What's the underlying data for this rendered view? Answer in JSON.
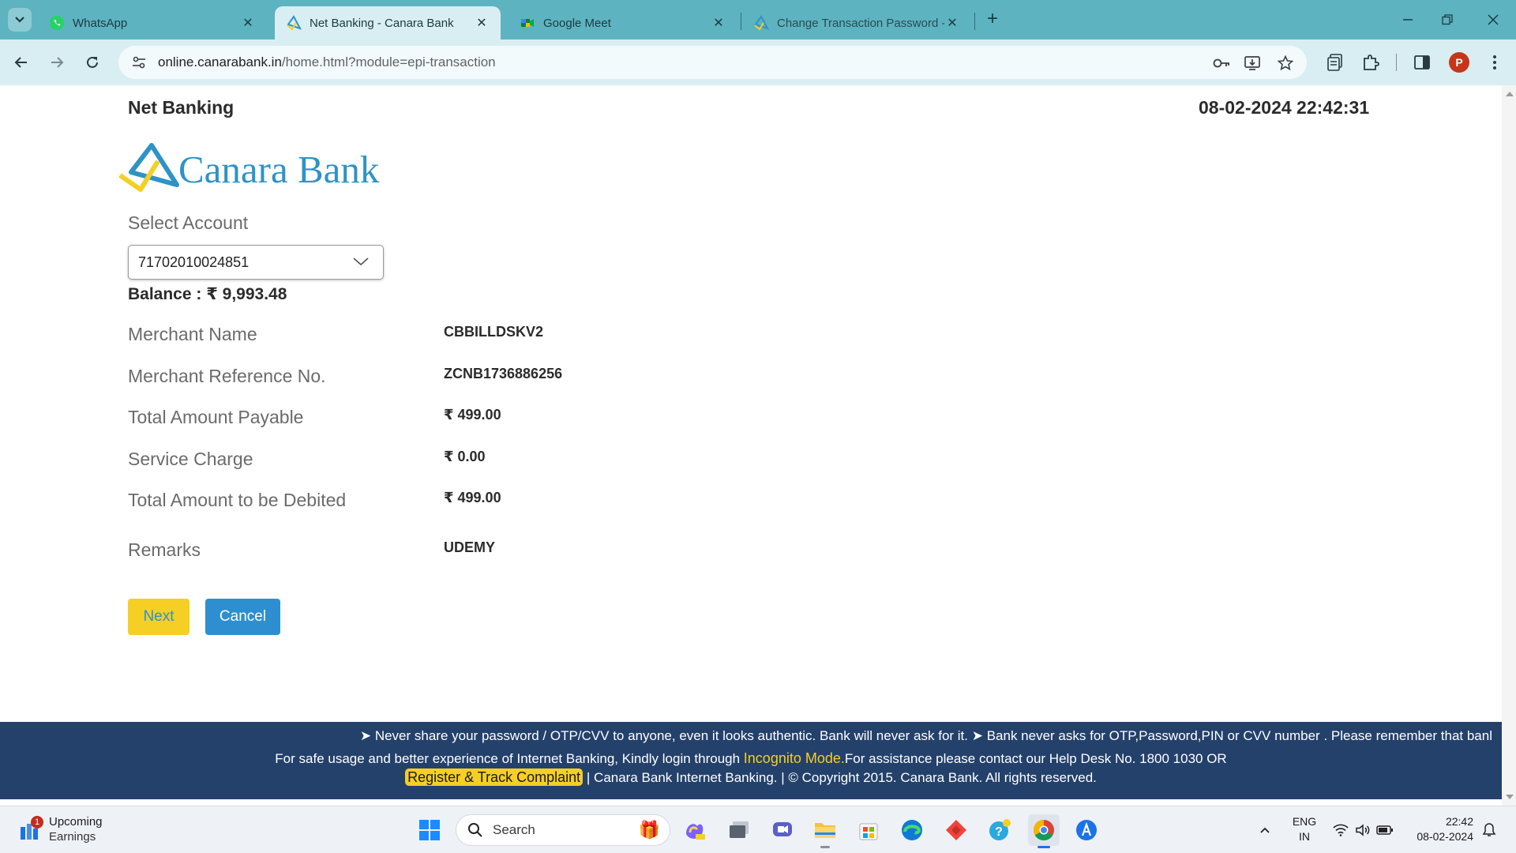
{
  "browser": {
    "tabs": [
      {
        "title": "WhatsApp",
        "icon": "whatsapp-icon",
        "active": false
      },
      {
        "title": "Net Banking - Canara Bank",
        "icon": "canara-bank-icon",
        "active": true
      },
      {
        "title": "Google Meet",
        "icon": "google-meet-icon",
        "active": false
      },
      {
        "title": "Change Transaction Password -",
        "icon": "canara-bank-icon",
        "active": false
      }
    ],
    "url": {
      "domain": "online.canarabank.in",
      "path": "/home.html?module=epi-transaction"
    },
    "profile_initial": "P"
  },
  "page": {
    "header_title": "Net Banking",
    "datetime": "08-02-2024 22:42:31",
    "bank_name": "Canara Bank",
    "select_account_label": "Select Account",
    "selected_account": "71702010024851",
    "balance": "Balance : ₹ 9,993.48",
    "details": [
      {
        "label": "Merchant Name",
        "value": "CBBILLDSKV2"
      },
      {
        "label": "Merchant Reference No.",
        "value": "ZCNB1736886256"
      },
      {
        "label": "Total Amount Payable",
        "value": "₹ 499.00"
      },
      {
        "label": "Service Charge",
        "value": "₹ 0.00"
      },
      {
        "label": "Total Amount to be Debited",
        "value": "₹ 499.00"
      },
      {
        "label": "Remarks",
        "value": "UDEMY"
      }
    ],
    "buttons": {
      "next": "Next",
      "cancel": "Cancel"
    },
    "footer": {
      "ticker": "➤ Never share your password / OTP/CVV to anyone, even it looks authentic. Bank will never ask for it. ➤ Bank never asks for OTP,Password,PIN or CVV number . Please remember that banl",
      "line1_prefix": "For safe usage and better experience of Internet Banking, Kindly login through ",
      "line1_highlight": "Incognito Mode.",
      "line1_suffix": "For assistance please contact our Help Desk No. 1800 1030 OR",
      "complaint_link": "Register & Track Complaint",
      "line2_suffix": "| Canara Bank Internet Banking. | © Copyright 2015. Canara Bank. All rights reserved."
    },
    "colors": {
      "brand_blue": "#2e93c6",
      "brand_yellow": "#f5cf23",
      "footer_bg": "#24416b",
      "tabstrip_bg": "#5db3c0"
    }
  },
  "taskbar": {
    "widget_badge": "1",
    "widget_title": "Upcoming",
    "widget_subtitle": "Earnings",
    "search_placeholder": "Search",
    "language": "ENG",
    "region": "IN",
    "time": "22:42",
    "date": "08-02-2024"
  }
}
